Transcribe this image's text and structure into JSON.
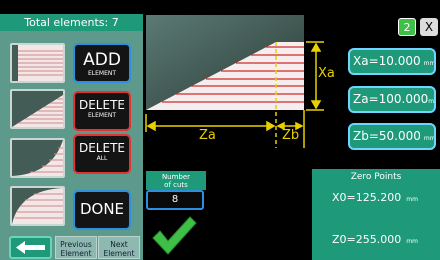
{
  "header": {
    "title": "Total elements: 7"
  },
  "top_right": {
    "page_badge": "2",
    "close_label": "X"
  },
  "element_types": [
    {
      "name": "straight"
    },
    {
      "name": "taper"
    },
    {
      "name": "convex-radius"
    },
    {
      "name": "concave-radius"
    }
  ],
  "actions": {
    "add": {
      "main": "ADD",
      "sub": "ELEMENT"
    },
    "delete_element": {
      "main": "DELETE",
      "sub": "ELEMENT"
    },
    "delete_all": {
      "main": "DELETE",
      "sub": "ALL"
    },
    "done": "DONE"
  },
  "nav": {
    "previous": [
      "Previous",
      "Element"
    ],
    "next": [
      "Next",
      "Element"
    ]
  },
  "drawing": {
    "labels": {
      "za": "Za",
      "zb": "Zb",
      "xa": "Xa"
    }
  },
  "cuts": {
    "label": [
      "Number",
      "of cuts"
    ],
    "value": "8"
  },
  "parameters": {
    "xa": {
      "text": "Xa=10.000",
      "unit": "mm"
    },
    "za": {
      "text": "Za=100.000",
      "unit": "mm"
    },
    "zb": {
      "text": "Zb=50.000",
      "unit": "mm"
    }
  },
  "zero_points": {
    "title": "Zero Points",
    "x0": {
      "text": "X0=125.200",
      "unit": "mm"
    },
    "z0": {
      "text": "Z0=255.000",
      "unit": "mm"
    }
  },
  "colors": {
    "accent": "#1e9a7a",
    "border_blue": "#2e8fe0",
    "danger": "#e03434",
    "dimension": "#e8d000",
    "cut_lines": "#d02a2a"
  }
}
